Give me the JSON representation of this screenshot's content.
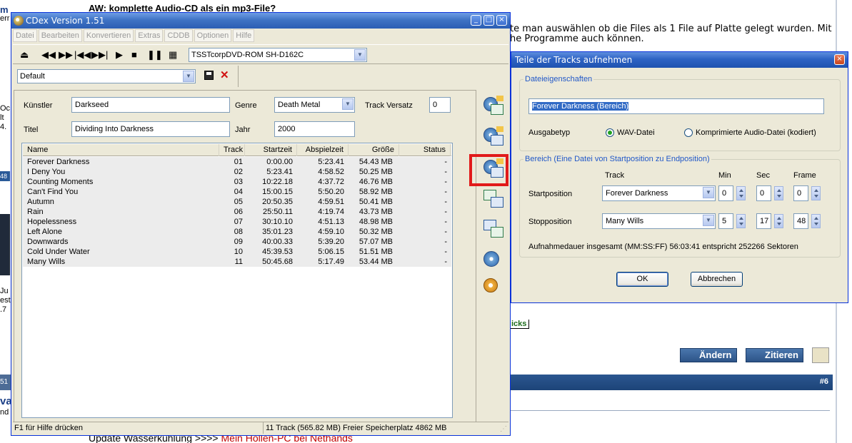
{
  "forum": {
    "post_title": "AW: komplette Audio-CD als ein mp3-File?",
    "post_text_line1": "te man auswählen ob die Files als 1 File auf Platte gelegt wurden. Mit",
    "post_text_line2": "he Programme auch können.",
    "tricks_label": "icks",
    "edit_button": "Ändern",
    "quote_button": "Zitieren",
    "post_number": "#6",
    "bar_left_text": "51",
    "bottom_line_text": "Update Wasserkühlung >>>> ",
    "bottom_line_link": "Mein Höllen-PC bei Nethands",
    "left_frag_1": "m",
    "left_frag_2": "err",
    "left_frag_3": "Oc",
    "left_frag_4": "lt",
    "left_frag_5": "4.",
    "left_frag_6": "48",
    "left_frag_7": "Ju",
    "left_frag_8": "est",
    "left_frag_9": ".7",
    "left_frag_10": "va",
    "left_frag_11": "nd"
  },
  "cdex": {
    "title": "CDex Version 1.51",
    "menu": [
      "Datei",
      "Bearbeiten",
      "Konvertieren",
      "Extras",
      "CDDB",
      "Optionen",
      "Hilfe"
    ],
    "drive": "TSSTcorpDVD-ROM SH-D162C",
    "profile": "Default",
    "labels": {
      "artist": "Künstler",
      "title": "Titel",
      "genre": "Genre",
      "year": "Jahr",
      "track_offset": "Track Versatz"
    },
    "values": {
      "artist": "Darkseed",
      "title": "Dividing Into Darkness",
      "genre": "Death Metal",
      "year": "2000",
      "track_offset": "0"
    },
    "columns": [
      "Name",
      "Track",
      "Startzeit",
      "Abspielzeit",
      "Größe",
      "Status"
    ],
    "tracks": [
      {
        "name": "Forever Darkness",
        "track": "01",
        "start": "0:00.00",
        "length": "5:23.41",
        "size": "54.43 MB",
        "status": "-"
      },
      {
        "name": "I Deny You",
        "track": "02",
        "start": "5:23.41",
        "length": "4:58.52",
        "size": "50.25 MB",
        "status": "-"
      },
      {
        "name": "Counting Moments",
        "track": "03",
        "start": "10:22.18",
        "length": "4:37.72",
        "size": "46.76 MB",
        "status": "-"
      },
      {
        "name": "Can't Find You",
        "track": "04",
        "start": "15:00.15",
        "length": "5:50.20",
        "size": "58.92 MB",
        "status": "-"
      },
      {
        "name": "Autumn",
        "track": "05",
        "start": "20:50.35",
        "length": "4:59.51",
        "size": "50.41 MB",
        "status": "-"
      },
      {
        "name": "Rain",
        "track": "06",
        "start": "25:50.11",
        "length": "4:19.74",
        "size": "43.73 MB",
        "status": "-"
      },
      {
        "name": "Hopelessness",
        "track": "07",
        "start": "30:10.10",
        "length": "4:51.13",
        "size": "48.98 MB",
        "status": "-"
      },
      {
        "name": "Left Alone",
        "track": "08",
        "start": "35:01.23",
        "length": "4:59.10",
        "size": "50.32 MB",
        "status": "-"
      },
      {
        "name": "Downwards",
        "track": "09",
        "start": "40:00.33",
        "length": "5:39.20",
        "size": "57.07 MB",
        "status": "-"
      },
      {
        "name": "Cold Under Water",
        "track": "10",
        "start": "45:39.53",
        "length": "5:06.15",
        "size": "51.51 MB",
        "status": "-"
      },
      {
        "name": "Many Wills",
        "track": "11",
        "start": "50:45.68",
        "length": "5:17.49",
        "size": "53.44 MB",
        "status": "-"
      }
    ],
    "status_left": "F1 für Hilfe drücken",
    "status_right": "11 Track (565.82 MB) Freier Speicherplatz  4862 MB"
  },
  "dialog": {
    "title": "Teile der Tracks aufnehmen",
    "group_file": "Dateieigenschaften",
    "filename": "Forever Darkness (Bereich)",
    "output_label": "Ausgabetyp",
    "radio_wav": "WAV-Datei",
    "radio_compressed": "Komprimierte Audio-Datei (kodiert)",
    "group_range": "Bereich (Eine Datei von Startposition zu Endposition)",
    "col_track": "Track",
    "col_min": "Min",
    "col_sec": "Sec",
    "col_frame": "Frame",
    "start_label": "Startposition",
    "stop_label": "Stopposition",
    "start_track": "Forever Darkness",
    "start_min": "0",
    "start_sec": "0",
    "start_frame": "0",
    "stop_track": "Many Wills",
    "stop_min": "5",
    "stop_sec": "17",
    "stop_frame": "48",
    "duration_text": "Aufnahmedauer insgesamt (MM:SS:FF) 56:03:41 entspricht 252266 Sektoren",
    "ok": "OK",
    "cancel": "Abbrechen"
  }
}
